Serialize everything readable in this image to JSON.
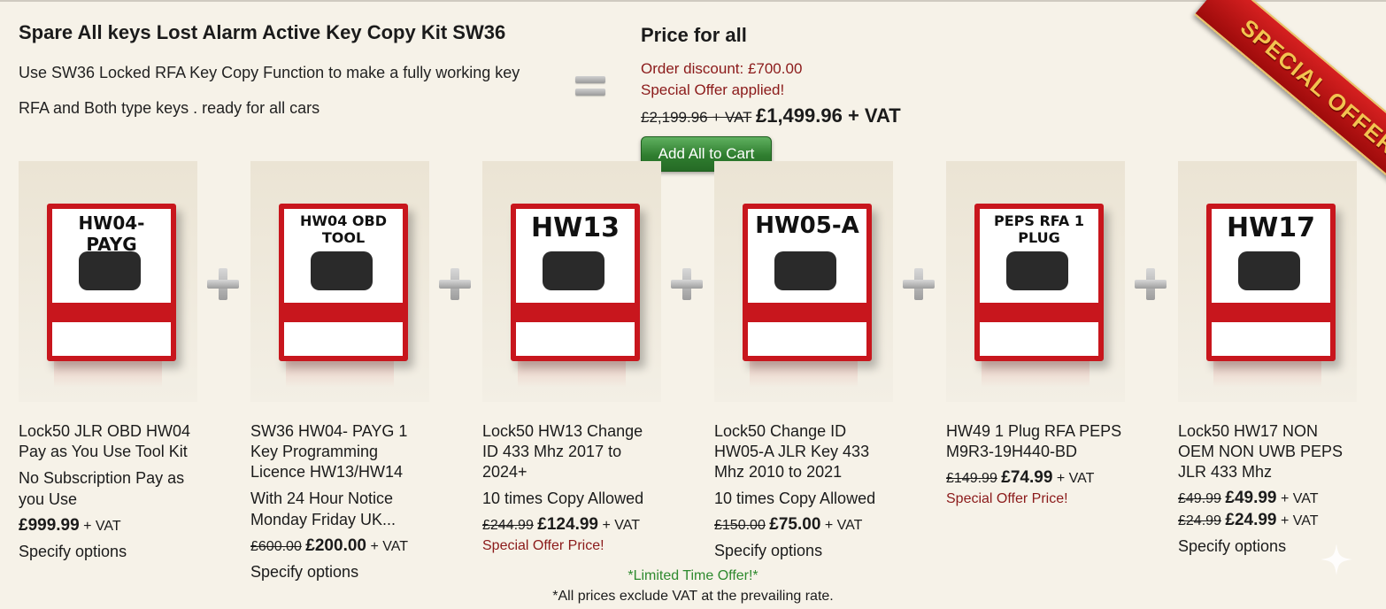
{
  "kit": {
    "title": "Spare All keys Lost Alarm Active Key Copy Kit SW36",
    "desc_line1": "Use SW36 Locked RFA Key Copy Function to make a fully working key",
    "desc_line2": "RFA and Both type keys  . ready for all cars"
  },
  "price_panel": {
    "title": "Price for all",
    "order_discount": "Order discount: £700.00",
    "special_applied": "Special Offer applied!",
    "old_total": "£2,199.96 + VAT",
    "new_total": "£1,499.96 + VAT",
    "add_all_label": "Add All to Cart"
  },
  "ribbon": {
    "text": "SPECIAL OFFER"
  },
  "products": [
    {
      "box_label": "HW04-PAYG",
      "name": "Lock50 JLR OBD HW04 Pay as You Use Tool Kit",
      "sub": "No Subscription Pay as you Use",
      "price_old": "",
      "price_new": "£999.99",
      "vat": "+ VAT",
      "specify": "Specify options",
      "offer": ""
    },
    {
      "box_label": "HW04 OBD TOOL",
      "name": "SW36 HW04- PAYG 1 Key Programming Licence HW13/HW14",
      "sub": "With 24 Hour Notice Monday Friday UK...",
      "price_old": "£600.00",
      "price_new": "£200.00",
      "vat": "+ VAT",
      "specify": "Specify options",
      "offer": ""
    },
    {
      "box_label": "HW13",
      "name": "Lock50 HW13 Change ID 433 Mhz 2017 to 2024+",
      "sub": "10 times Copy Allowed",
      "price_old": "£244.99",
      "price_new": "£124.99",
      "vat": "+ VAT",
      "specify": "",
      "offer": "Special Offer Price!"
    },
    {
      "box_label": "HW05-A",
      "name": "Lock50 Change ID HW05-A JLR Key 433 Mhz 2010 to 2021",
      "sub": "10 times Copy Allowed",
      "price_old": "£150.00",
      "price_new": "£75.00",
      "vat": "+ VAT",
      "specify": "Specify options",
      "offer": ""
    },
    {
      "box_label": "PEPS RFA 1 PLUG",
      "name": "HW49 1 Plug RFA PEPS M9R3-19H440-BD",
      "sub": "",
      "price_old": "£149.99",
      "price_new": "£74.99",
      "vat": "+ VAT",
      "specify": "",
      "offer": "Special Offer Price!"
    },
    {
      "box_label": "HW17",
      "name": "Lock50 HW17 NON OEM NON UWB PEPS JLR 433 Mhz",
      "sub": "",
      "price_old": "£49.99",
      "price_new": "£49.99",
      "vat": "+ VAT",
      "price_old2": "£24.99",
      "price_new2": "£24.99",
      "specify": "Specify options",
      "offer": ""
    }
  ],
  "footer": {
    "limited": "*Limited Time Offer!*",
    "vat_note": "*All prices exclude VAT at the prevailing rate."
  },
  "colors": {
    "accent_red": "#8b1a1a",
    "button_green": "#2f7d2f",
    "limited_green": "#2e8a2e",
    "background": "#f6f2e8"
  }
}
